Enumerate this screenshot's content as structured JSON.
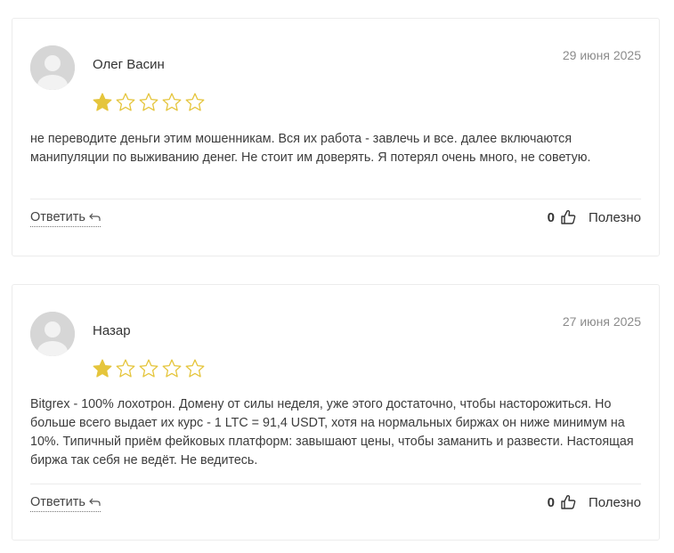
{
  "reviews": [
    {
      "author": "Олег Васин",
      "date": "29 июня 2025",
      "rating": 1,
      "max_rating": 5,
      "text": "не переводите деньги этим мошенникам. Вся их работа - завлечь и все. далее включаются манипуляции по выживанию денег. Не стоит им доверять. Я потерял очень много, не советую.",
      "reply_label": "Ответить",
      "helpful_count": "0",
      "helpful_label": "Полезно"
    },
    {
      "author": "Назар",
      "date": "27 июня 2025",
      "rating": 1,
      "max_rating": 5,
      "text": "Bitgrex - 100% лохотрон. Домену от силы неделя, уже этого достаточно, чтобы насторожиться. Но больше всего выдает их курс - 1 LTC = 91,4 USDT, хотя на нормальных биржах он ниже минимум на 10%. Типичный приём фейковых платформ: завышают цены, чтобы заманить и развести. Настоящая биржа так себя не ведёт. Не ведитесь.",
      "reply_label": "Ответить",
      "helpful_count": "0",
      "helpful_label": "Полезно"
    }
  ],
  "colors": {
    "star_filled": "#e5c53c",
    "star_outline": "#e5c53c",
    "avatar_bg": "#d6d6d6",
    "avatar_fg": "#f2f2f2"
  },
  "icons": {
    "avatar": "user-silhouette-icon",
    "star": "star-icon",
    "reply": "reply-arrow-icon",
    "helpful": "thumbs-up-icon"
  }
}
